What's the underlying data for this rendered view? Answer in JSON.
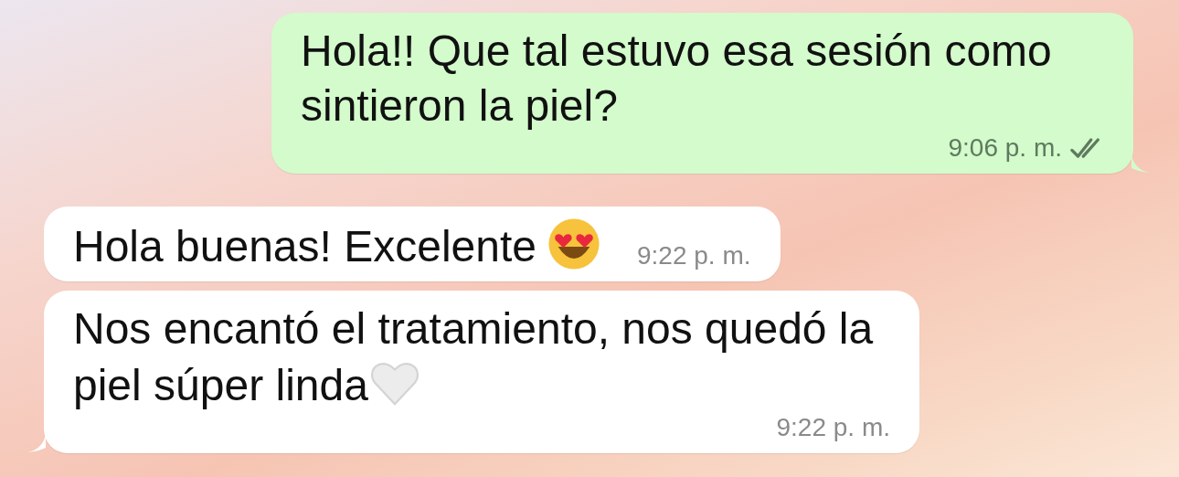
{
  "messages": [
    {
      "kind": "outgoing",
      "text": "Hola!! Que tal estuvo esa sesión como sintieron la piel?",
      "time": "9:06 p. m.",
      "read": true,
      "tail": true
    },
    {
      "kind": "incoming",
      "text": "Hola buenas! Excelente",
      "emoji": {
        "kind": "heart-eyes"
      },
      "time": "9:22 p. m.",
      "tail": false
    },
    {
      "kind": "incoming",
      "text": "Nos encantó el tratamiento, nos quedó la piel súper linda",
      "emoji": {
        "kind": "white-heart"
      },
      "time": "9:22 p. m.",
      "tail": true
    }
  ]
}
